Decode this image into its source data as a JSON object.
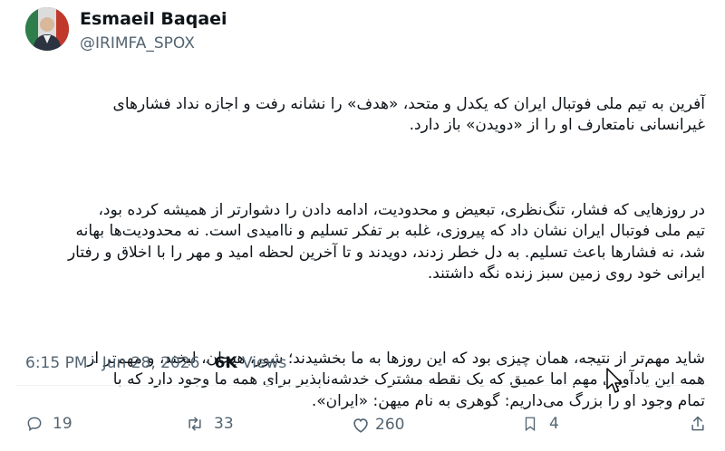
{
  "author": {
    "name": "Esmaeil Baqaei",
    "handle": "@IRIMFA_SPOX"
  },
  "tweet": {
    "paragraphs": [
      "آفرین به تیم ملی فوتبال ایران که یکدل و متحد، «هدف» را نشانه رفت و اجازه نداد فشارهای\nغیرانسانی نامتعارف او را از «دویدن» باز دارد.",
      "در روزهایی که فشار، تنگ‌نظری، تبعیض و محدودیت، ادامه دادن را دشوارتر از همیشه کرده بود،\nتیم ملی فوتبال ایران نشان داد که پیروزی، غلبه بر تفکر تسلیم و ناامیدی است. نه محدودیت‌ها بهانه\nشد، نه فشارها باعث تسلیم. به دل خطر زدند، دویدند و تا آخرین لحظه امید و مهر را با اخلاق و رفتار\nایرانی خود روی زمین سبز زنده نگه داشتند.",
      "شاید مهم‌تر از نتیجه، همان چیزی بود که این روزها به ما بخشیدند؛ شور، هیجان، لبخند، و مهم‌تر از\nهمه این یادآوری مهم اما عمیق که یک نقطه مشترک خدشه‌ناپذیر برای همه ما وجود دارد که با\nتمام وجود او را بزرگ می‌داریم: گوهری به نام میهن: «ایران»."
    ]
  },
  "meta": {
    "time": "6:15 PM",
    "date": "Jun 28, 2026",
    "views_count": "6K",
    "views_label": "Views"
  },
  "actions": {
    "reply_count": "19",
    "retweet_count": "33",
    "like_count": "260",
    "bookmark_count": "4"
  },
  "colors": {
    "text": "#0f1419",
    "secondary": "#536471",
    "divider": "#eff3f4"
  },
  "icons": [
    "reply-icon",
    "retweet-icon",
    "like-icon",
    "bookmark-icon",
    "share-icon",
    "cursor-icon"
  ]
}
